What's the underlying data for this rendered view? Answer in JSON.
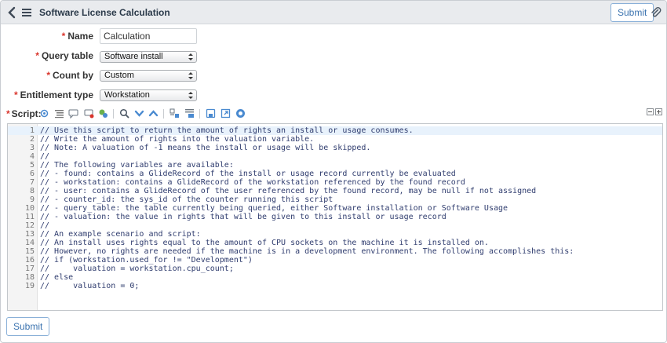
{
  "header": {
    "title": "Software License Calculation",
    "submit_label": "Submit"
  },
  "form": {
    "name": {
      "label": "Name",
      "value": "Calculation"
    },
    "query_table": {
      "label": "Query table",
      "value": "Software install"
    },
    "count_by": {
      "label": "Count by",
      "value": "Custom"
    },
    "entitlement_type": {
      "label": "Entitlement type",
      "value": "Workstation"
    },
    "required_marker": "*",
    "script_label": "Script:"
  },
  "editor": {
    "lines": [
      {
        "n": "1",
        "text": "// Use this script to return the amount of rights an install or usage consumes."
      },
      {
        "n": "2",
        "text": "// Write the amount of rights into the valuation variable."
      },
      {
        "n": "3",
        "text": "// Note: A valuation of -1 means the install or usage will be skipped."
      },
      {
        "n": "4",
        "text": "//"
      },
      {
        "n": "5",
        "text": "// The following variables are available:"
      },
      {
        "n": "6",
        "text": "// - found: contains a GlideRecord of the install or usage record currently be evaluated"
      },
      {
        "n": "7",
        "text": "// - workstation: contains a GlideRecord of the workstation referenced by the found record"
      },
      {
        "n": "8",
        "text": "// - user: contains a GlideRecord of the user referenced by the found record, may be null if not assigned"
      },
      {
        "n": "9",
        "text": "// - counter_id: the sys_id of the counter running this script"
      },
      {
        "n": "10",
        "text": "// - query_table: the table currently being queried, either Software installation or Software Usage"
      },
      {
        "n": "11",
        "text": "// - valuation: the value in rights that will be given to this install or usage record"
      },
      {
        "n": "12",
        "text": "//"
      },
      {
        "n": "13",
        "text": "// An example scenario and script:"
      },
      {
        "n": "14",
        "text": "// An install uses rights equal to the amount of CPU sockets on the machine it is installed on."
      },
      {
        "n": "15",
        "text": "// However, no rights are needed if the machine is in a development environment. The following accomplishes this:"
      },
      {
        "n": "16",
        "text": "// if (workstation.used_for != \"Development\")"
      },
      {
        "n": "17",
        "text": "//     valuation = workstation.cpu_count;"
      },
      {
        "n": "18",
        "text": "// else"
      },
      {
        "n": "19",
        "text": "//     valuation = 0;"
      }
    ]
  },
  "footer": {
    "submit_label": "Submit"
  },
  "colors": {
    "accent": "#3b73af",
    "required": "#d9352c",
    "header_bg": "#e9ebee"
  }
}
